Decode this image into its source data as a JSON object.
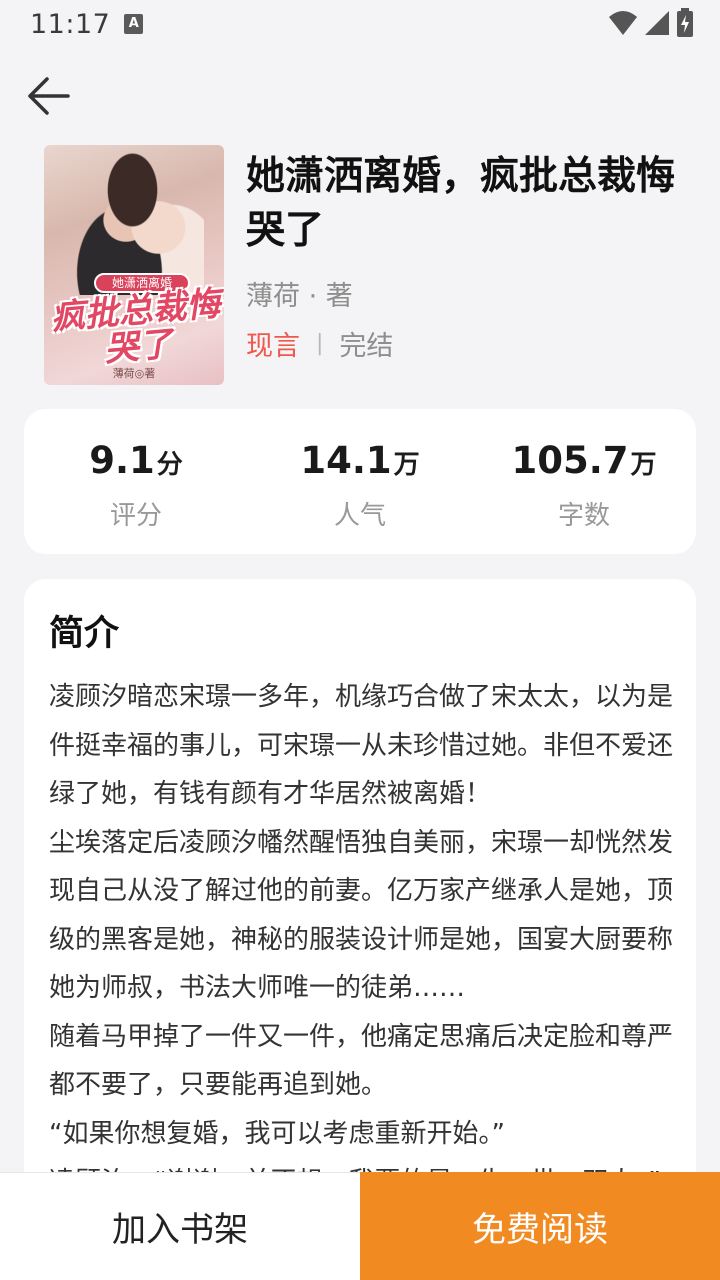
{
  "status_bar": {
    "time": "11:17",
    "notification_badge": "A"
  },
  "header": {
    "back_icon": "arrow-left-icon"
  },
  "book": {
    "title": "她潇洒离婚，疯批总裁悔哭了",
    "author": "薄荷 · 著",
    "genre": "现言",
    "separator": "|",
    "status": "完结",
    "cover": {
      "ribbon_text": "她潇洒离婚",
      "art_title": "疯批总裁悔哭了",
      "art_author": "薄荷◎著"
    }
  },
  "stats": [
    {
      "value": "9.1",
      "unit": "分",
      "label": "评分"
    },
    {
      "value": "14.1",
      "unit": "万",
      "label": "人气"
    },
    {
      "value": "105.7",
      "unit": "万",
      "label": "字数"
    }
  ],
  "intro": {
    "heading": "简介",
    "text": "凌顾汐暗恋宋璟一多年，机缘巧合做了宋太太，以为是件挺幸福的事儿，可宋璟一从未珍惜过她。非但不爱还绿了她，有钱有颜有才华居然被离婚！\n尘埃落定后凌顾汐幡然醒悟独自美丽，宋璟一却恍然发现自己从没了解过他的前妻。亿万家产继承人是她，顶级的黑客是她，神秘的服装设计师是她，国宴大厨要称她为师叔，书法大师唯一的徒弟……\n随着马甲掉了一件又一件，他痛定思痛后决定脸和尊严都不要了，只要能再追到她。\n“如果你想复婚，我可以考虑重新开始。”\n凌顾汐：“谢谢，并不想，我要的是一生一世一双人。”"
  },
  "actions": {
    "add_shelf": "加入书架",
    "read_free": "免费阅读"
  },
  "colors": {
    "accent_orange": "#f28a22",
    "genre_red": "#f0574d"
  }
}
